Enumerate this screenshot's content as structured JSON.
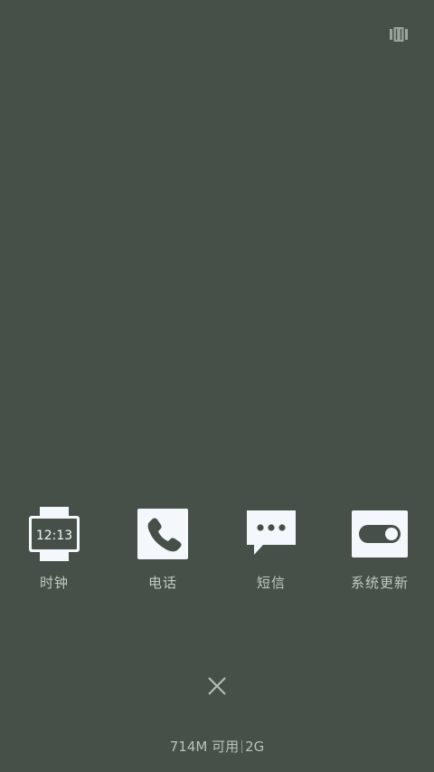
{
  "apps": [
    {
      "label": "时钟",
      "icon": "watch-icon",
      "icon_text": "12:13"
    },
    {
      "label": "电话",
      "icon": "phone-icon"
    },
    {
      "label": "短信",
      "icon": "message-icon"
    },
    {
      "label": "系统更新",
      "icon": "toggle-switch-icon"
    }
  ],
  "status": {
    "memory": "714M 可用",
    "total": "2G"
  },
  "colors": {
    "background": "#465048",
    "icon_fill": "#f4f7fb",
    "icon_dark": "#465048"
  }
}
